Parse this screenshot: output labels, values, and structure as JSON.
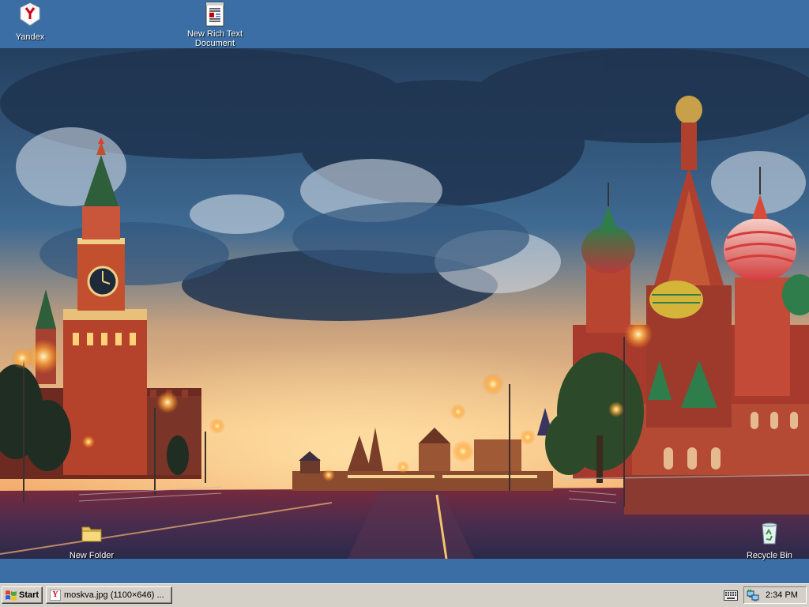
{
  "desktop": {
    "icons": [
      {
        "label": "Yandex",
        "icon": "yandex-icon"
      },
      {
        "label": "New Rich Text Document",
        "icon": "rich-text-document-icon"
      },
      {
        "label": "New Folder",
        "icon": "folder-icon"
      },
      {
        "label": "Recycle Bin",
        "icon": "recycle-bin-icon"
      }
    ],
    "background_color": "#3a6ea5"
  },
  "taskbar": {
    "start_label": "Start",
    "tasks": [
      {
        "label": "moskva.jpg (1100×646) ...",
        "icon": "yandex-browser-icon"
      }
    ],
    "tray": {
      "icons": [
        "keyboard-icon",
        "network-icon"
      ],
      "time": "2:34 PM"
    }
  },
  "colors": {
    "taskbar": "#d4d0c8",
    "icon_text": "#ffffff"
  }
}
